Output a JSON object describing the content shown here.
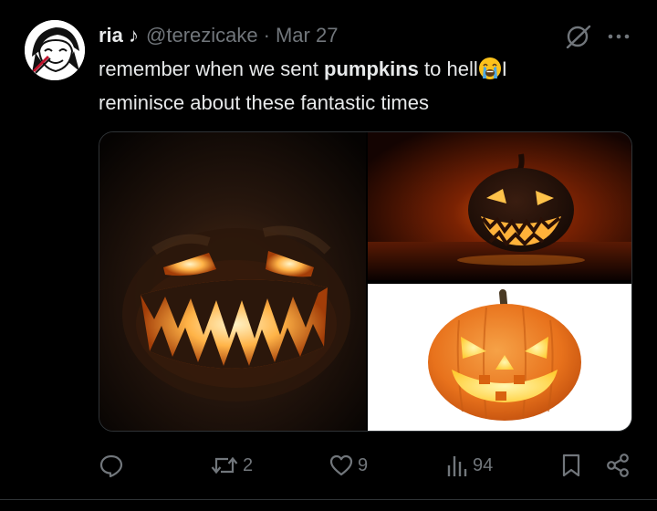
{
  "author": {
    "display_name": "ria ♪",
    "handle": "@terezicake",
    "separator": "·",
    "date": "Mar 27"
  },
  "tweet": {
    "text_before": "remember when we sent ",
    "text_bold": "pumpkins",
    "text_after_a": " to hell",
    "emoji": "loudly-crying-face",
    "text_after_b": "I",
    "line2": "reminisce about these fantastic times"
  },
  "media": [
    {
      "name": "smoky-jack-o-lantern"
    },
    {
      "name": "jack-o-lantern-dark"
    },
    {
      "name": "jack-o-lantern-white-background"
    }
  ],
  "stats": {
    "replies": "",
    "reposts": "2",
    "likes": "9",
    "views": "94"
  },
  "icons": {
    "reply": "reply-icon",
    "repost": "repost-icon",
    "like": "heart-icon",
    "views": "views-icon",
    "bookmark": "bookmark-icon",
    "share": "share-icon",
    "grok": "grok-icon",
    "more": "more-icon"
  },
  "colors": {
    "background": "#000000",
    "text": "#e7e9ea",
    "muted": "#71767b",
    "pumpkin": "#e8721c",
    "glow": "#ffb347"
  }
}
